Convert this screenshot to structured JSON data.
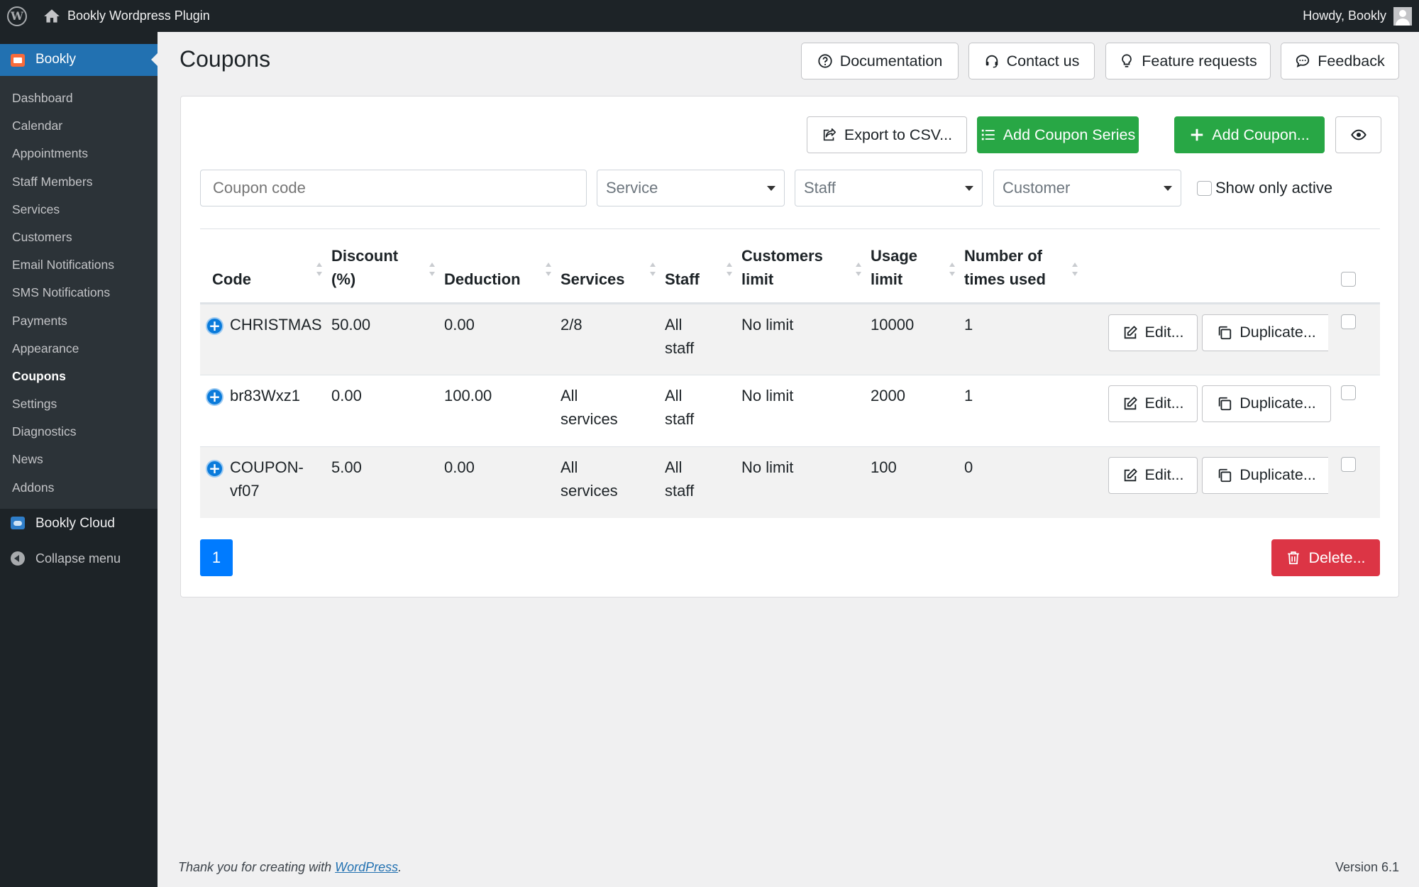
{
  "adminbar": {
    "site_name": "Bookly Wordpress Plugin",
    "greeting": "Howdy, Bookly"
  },
  "sidebar": {
    "active": "Bookly",
    "items": [
      "Dashboard",
      "Calendar",
      "Appointments",
      "Staff Members",
      "Services",
      "Customers",
      "Email Notifications",
      "SMS Notifications",
      "Payments",
      "Appearance",
      "Coupons",
      "Settings",
      "Diagnostics",
      "News",
      "Addons"
    ],
    "current": "Coupons",
    "cloud": "Bookly Cloud",
    "collapse": "Collapse menu"
  },
  "page": {
    "title": "Coupons"
  },
  "header_buttons": {
    "documentation": "Documentation",
    "contact": "Contact us",
    "features": "Feature requests",
    "feedback": "Feedback"
  },
  "toolbar": {
    "export": "Export to CSV...",
    "add_series": "Add Coupon Series",
    "add_coupon": "Add Coupon..."
  },
  "filters": {
    "code_placeholder": "Coupon code",
    "service": "Service",
    "staff": "Staff",
    "customer": "Customer",
    "show_active": "Show only active"
  },
  "table": {
    "headers": {
      "code": "Code",
      "discount1": "Discount",
      "discount2": "(%)",
      "deduction": "Deduction",
      "services": "Services",
      "staff": "Staff",
      "climit1": "Customers",
      "climit2": "limit",
      "ulimit1": "Usage",
      "ulimit2": "limit",
      "times1": "Number of",
      "times2": "times used"
    },
    "rows": [
      {
        "code1": "CHRISTMAS",
        "code2": "",
        "discount": "50.00",
        "deduction": "0.00",
        "services1": "2/8",
        "services2": "",
        "staff1": "All",
        "staff2": "staff",
        "customers_limit": "No limit",
        "usage_limit": "10000",
        "times_used": "1"
      },
      {
        "code1": "br83Wxz1",
        "code2": "",
        "discount": "0.00",
        "deduction": "100.00",
        "services1": "All",
        "services2": "services",
        "staff1": "All",
        "staff2": "staff",
        "customers_limit": "No limit",
        "usage_limit": "2000",
        "times_used": "1"
      },
      {
        "code1": "COUPON-",
        "code2": "vf07",
        "discount": "5.00",
        "deduction": "0.00",
        "services1": "All",
        "services2": "services",
        "staff1": "All",
        "staff2": "staff",
        "customers_limit": "No limit",
        "usage_limit": "100",
        "times_used": "0"
      }
    ],
    "edit_label": "Edit...",
    "duplicate_label": "Duplicate..."
  },
  "pagination": {
    "current": "1"
  },
  "delete_label": "Delete...",
  "footer": {
    "text": "Thank you for creating with ",
    "link": "WordPress",
    "end": ".",
    "version": "Version 6.1"
  }
}
